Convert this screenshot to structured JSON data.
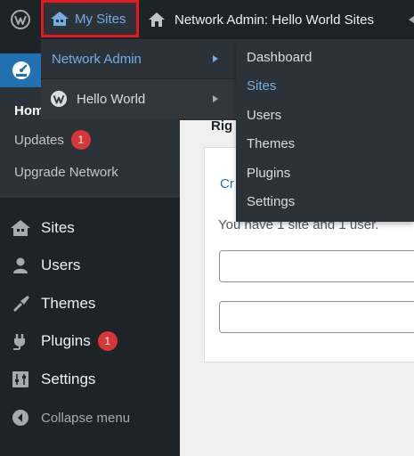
{
  "adminbar": {
    "my_sites_label": "My Sites",
    "home_label": "Network Admin: Hello World Sites",
    "wp_logo_icon": "wordpress-logo-icon",
    "my_sites_icon": "multisite-icon",
    "home_icon": "home-icon"
  },
  "dropdown_primary": {
    "items": [
      {
        "label": "Network Admin",
        "state": "active"
      },
      {
        "label": "Hello World",
        "icon": "wordpress-logo-icon"
      }
    ]
  },
  "dropdown_network_admin": {
    "items": [
      {
        "label": "Dashboard"
      },
      {
        "label": "Sites",
        "state": "current"
      },
      {
        "label": "Users"
      },
      {
        "label": "Themes"
      },
      {
        "label": "Plugins"
      },
      {
        "label": "Settings"
      }
    ]
  },
  "sidebar": {
    "dashboard_icon": "dashboard-gauge-icon",
    "submenu": [
      {
        "label": "Hom",
        "state": "current"
      },
      {
        "label": "Updates",
        "badge": "1"
      },
      {
        "label": "Upgrade Network"
      }
    ],
    "items": [
      {
        "label": "Sites",
        "icon": "sites-icon"
      },
      {
        "label": "Users",
        "icon": "users-icon"
      },
      {
        "label": "Themes",
        "icon": "themes-brush-icon"
      },
      {
        "label": "Plugins",
        "icon": "plugins-icon",
        "badge": "1"
      },
      {
        "label": "Settings",
        "icon": "settings-sliders-icon"
      },
      {
        "label": "Collapse menu",
        "icon": "collapse-arrow-icon"
      }
    ]
  },
  "content": {
    "box_title_partial": "Rig",
    "create_link_partial": "Cr",
    "summary_text": "You have 1 site and 1 user."
  },
  "colors": {
    "adminbar_bg": "#1d2327",
    "menu_bg": "#2c3338",
    "accent_blue": "#72aee6",
    "primary_blue": "#2271b1",
    "badge_red": "#d63638",
    "highlight_border": "#e4181e"
  }
}
